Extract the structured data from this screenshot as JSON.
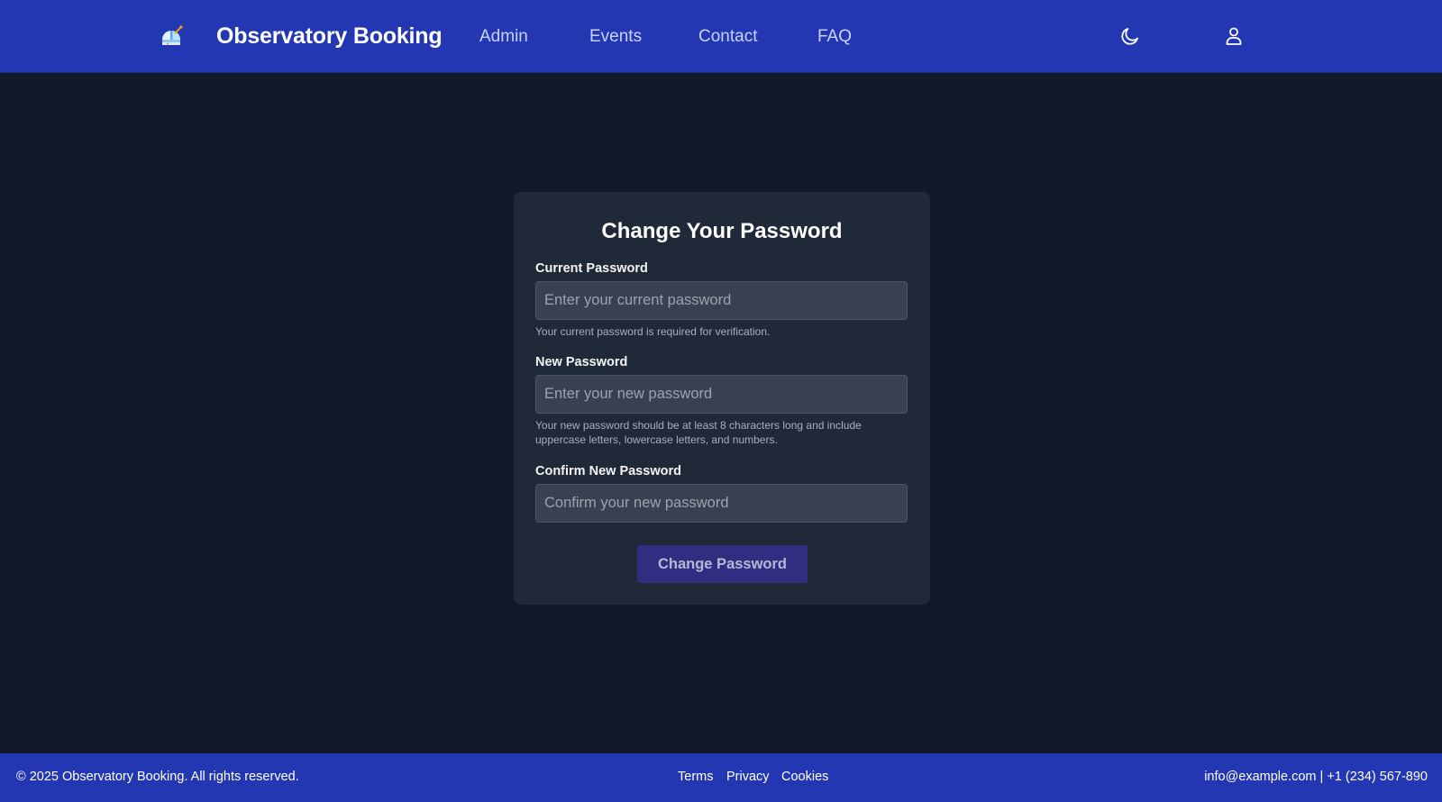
{
  "header": {
    "logo_icon": "observatory-icon",
    "brand": "Observatory Booking",
    "nav": {
      "admin": "Admin",
      "events": "Events",
      "contact": "Contact",
      "faq": "FAQ"
    },
    "theme_toggle_icon": "moon-icon",
    "account_icon": "user-icon"
  },
  "form": {
    "title": "Change Your Password",
    "current_password": {
      "label": "Current Password",
      "placeholder": "Enter your current password",
      "value": "",
      "help": "Your current password is required for verification."
    },
    "new_password": {
      "label": "New Password",
      "placeholder": "Enter your new password",
      "value": "",
      "help": "Your new password should be at least 8 characters long and include uppercase letters, lowercase letters, and numbers."
    },
    "confirm_password": {
      "label": "Confirm New Password",
      "placeholder": "Confirm your new password",
      "value": ""
    },
    "submit_label": "Change Password"
  },
  "footer": {
    "copyright": "© 2025 Observatory Booking. All rights reserved.",
    "links": {
      "terms": "Terms",
      "privacy": "Privacy",
      "cookies": "Cookies"
    },
    "contact": "info@example.com | +1 (234) 567-890"
  },
  "colors": {
    "header_bg": "#2337b3",
    "page_bg": "#111827",
    "card_bg": "#1f2937",
    "input_bg": "#374151",
    "button_bg": "#312e81"
  }
}
